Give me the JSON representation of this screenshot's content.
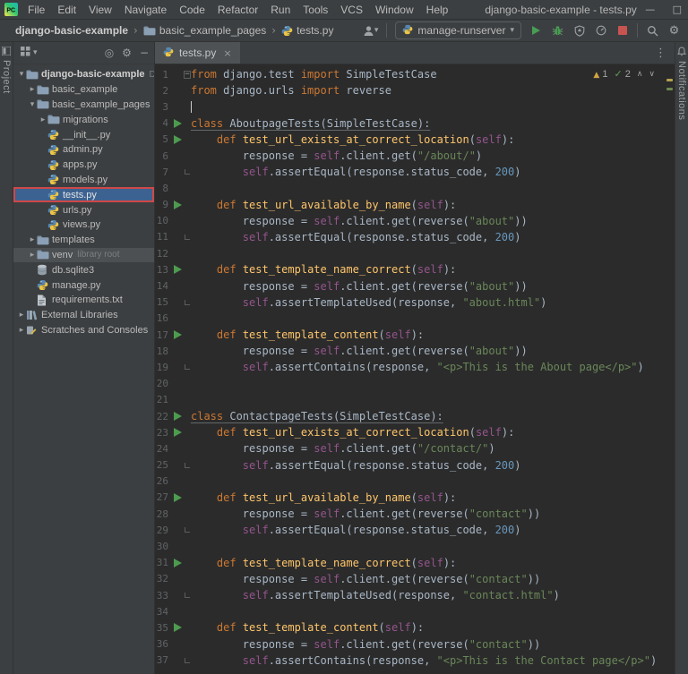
{
  "title_bar": {
    "menus": [
      "File",
      "Edit",
      "View",
      "Navigate",
      "Code",
      "Refactor",
      "Run",
      "Tools",
      "VCS",
      "Window",
      "Help"
    ],
    "title": "django-basic-example - tests.py"
  },
  "toolbar": {
    "breadcrumbs": [
      {
        "label": "django-basic-example"
      },
      {
        "label": "basic_example_pages",
        "icon": "folder"
      },
      {
        "label": "tests.py",
        "icon": "python"
      }
    ],
    "run_config": "manage-runserver"
  },
  "left_stripe": {
    "label": "Project"
  },
  "right_stripe": {
    "label": "Notifications"
  },
  "project": {
    "items": [
      {
        "label": "django-basic-example",
        "suffix": "D:\\",
        "icon": "folder",
        "chev": "down",
        "indent": 0
      },
      {
        "label": "basic_example",
        "icon": "folder",
        "chev": "right",
        "indent": 1
      },
      {
        "label": "basic_example_pages",
        "icon": "folder",
        "chev": "down",
        "indent": 1
      },
      {
        "label": "migrations",
        "icon": "folder",
        "chev": "right",
        "indent": 2
      },
      {
        "label": "__init__.py",
        "icon": "python",
        "indent": 2
      },
      {
        "label": "admin.py",
        "icon": "python",
        "indent": 2
      },
      {
        "label": "apps.py",
        "icon": "python",
        "indent": 2
      },
      {
        "label": "models.py",
        "icon": "python",
        "indent": 2
      },
      {
        "label": "tests.py",
        "icon": "python",
        "indent": 2,
        "selected": true
      },
      {
        "label": "urls.py",
        "icon": "python",
        "indent": 2
      },
      {
        "label": "views.py",
        "icon": "python",
        "indent": 2
      },
      {
        "label": "templates",
        "icon": "folder",
        "chev": "right",
        "indent": 1
      },
      {
        "label": "venv",
        "suffix": "library root",
        "icon": "folder",
        "chev": "right",
        "indent": 1,
        "muted": true
      },
      {
        "label": "db.sqlite3",
        "icon": "database",
        "indent": 1
      },
      {
        "label": "manage.py",
        "icon": "python",
        "indent": 1
      },
      {
        "label": "requirements.txt",
        "icon": "text",
        "indent": 1
      },
      {
        "label": "External Libraries",
        "icon": "libraries",
        "chev": "right",
        "indent": 0
      },
      {
        "label": "Scratches and Consoles",
        "icon": "scratches",
        "chev": "right",
        "indent": 0
      }
    ]
  },
  "tabs": [
    {
      "label": "tests.py"
    }
  ],
  "editor": {
    "inspections": {
      "warnings": "1",
      "passed": "2"
    },
    "lines": [
      {
        "n": 1,
        "fs": true,
        "t": [
          [
            "k",
            "from"
          ],
          [
            "p",
            " django.test "
          ],
          [
            "k",
            "import"
          ],
          [
            "p",
            " SimpleTestCase"
          ]
        ]
      },
      {
        "n": 2,
        "t": [
          [
            "k",
            "from"
          ],
          [
            "p",
            " django.urls "
          ],
          [
            "k",
            "import"
          ],
          [
            "p",
            " reverse"
          ]
        ]
      },
      {
        "n": 3,
        "cursor": true,
        "t": []
      },
      {
        "n": 4,
        "run": true,
        "u": true,
        "t": [
          [
            "k",
            "class"
          ],
          [
            "p",
            " AboutpageTests(SimpleTestCase):"
          ]
        ]
      },
      {
        "n": 5,
        "run": true,
        "t": [
          [
            "p",
            "    "
          ],
          [
            "k",
            "def"
          ],
          [
            "p",
            " "
          ],
          [
            "f",
            "test_url_exists_at_correct_location"
          ],
          [
            "p",
            "("
          ],
          [
            "sf",
            "self"
          ],
          [
            "p",
            "):"
          ]
        ]
      },
      {
        "n": 6,
        "t": [
          [
            "p",
            "        response = "
          ],
          [
            "sf",
            "self"
          ],
          [
            "p",
            ".client.get("
          ],
          [
            "s",
            "\"/about/\""
          ],
          [
            "p",
            ")"
          ]
        ]
      },
      {
        "n": 7,
        "fe": true,
        "t": [
          [
            "p",
            "        "
          ],
          [
            "sf",
            "self"
          ],
          [
            "p",
            ".assertEqual(response.status_code, "
          ],
          [
            "nm",
            "200"
          ],
          [
            "p",
            ")"
          ]
        ]
      },
      {
        "n": 8,
        "t": []
      },
      {
        "n": 9,
        "run": true,
        "t": [
          [
            "p",
            "    "
          ],
          [
            "k",
            "def"
          ],
          [
            "p",
            " "
          ],
          [
            "f",
            "test_url_available_by_name"
          ],
          [
            "p",
            "("
          ],
          [
            "sf",
            "self"
          ],
          [
            "p",
            "):"
          ]
        ]
      },
      {
        "n": 10,
        "t": [
          [
            "p",
            "        response = "
          ],
          [
            "sf",
            "self"
          ],
          [
            "p",
            ".client.get(reverse("
          ],
          [
            "s",
            "\"about\""
          ],
          [
            "p",
            "))"
          ]
        ]
      },
      {
        "n": 11,
        "fe": true,
        "t": [
          [
            "p",
            "        "
          ],
          [
            "sf",
            "self"
          ],
          [
            "p",
            ".assertEqual(response.status_code, "
          ],
          [
            "nm",
            "200"
          ],
          [
            "p",
            ")"
          ]
        ]
      },
      {
        "n": 12,
        "t": []
      },
      {
        "n": 13,
        "run": true,
        "t": [
          [
            "p",
            "    "
          ],
          [
            "k",
            "def"
          ],
          [
            "p",
            " "
          ],
          [
            "f",
            "test_template_name_correct"
          ],
          [
            "p",
            "("
          ],
          [
            "sf",
            "self"
          ],
          [
            "p",
            "):"
          ]
        ]
      },
      {
        "n": 14,
        "t": [
          [
            "p",
            "        response = "
          ],
          [
            "sf",
            "self"
          ],
          [
            "p",
            ".client.get(reverse("
          ],
          [
            "s",
            "\"about\""
          ],
          [
            "p",
            "))"
          ]
        ]
      },
      {
        "n": 15,
        "fe": true,
        "t": [
          [
            "p",
            "        "
          ],
          [
            "sf",
            "self"
          ],
          [
            "p",
            ".assertTemplateUsed(response, "
          ],
          [
            "s",
            "\"about.html\""
          ],
          [
            "p",
            ")"
          ]
        ]
      },
      {
        "n": 16,
        "t": []
      },
      {
        "n": 17,
        "run": true,
        "t": [
          [
            "p",
            "    "
          ],
          [
            "k",
            "def"
          ],
          [
            "p",
            " "
          ],
          [
            "f",
            "test_template_content"
          ],
          [
            "p",
            "("
          ],
          [
            "sf",
            "self"
          ],
          [
            "p",
            "):"
          ]
        ]
      },
      {
        "n": 18,
        "t": [
          [
            "p",
            "        response = "
          ],
          [
            "sf",
            "self"
          ],
          [
            "p",
            ".client.get(reverse("
          ],
          [
            "s",
            "\"about\""
          ],
          [
            "p",
            "))"
          ]
        ]
      },
      {
        "n": 19,
        "fe": true,
        "t": [
          [
            "p",
            "        "
          ],
          [
            "sf",
            "self"
          ],
          [
            "p",
            ".assertContains(response, "
          ],
          [
            "s",
            "\"<p>This is the About page</p>\""
          ],
          [
            "p",
            ")"
          ]
        ]
      },
      {
        "n": 20,
        "t": []
      },
      {
        "n": 21,
        "t": []
      },
      {
        "n": 22,
        "run": true,
        "u": true,
        "t": [
          [
            "k",
            "class"
          ],
          [
            "p",
            " ContactpageTests(SimpleTestCase):"
          ]
        ]
      },
      {
        "n": 23,
        "run": true,
        "t": [
          [
            "p",
            "    "
          ],
          [
            "k",
            "def"
          ],
          [
            "p",
            " "
          ],
          [
            "f",
            "test_url_exists_at_correct_location"
          ],
          [
            "p",
            "("
          ],
          [
            "sf",
            "self"
          ],
          [
            "p",
            "):"
          ]
        ]
      },
      {
        "n": 24,
        "t": [
          [
            "p",
            "        response = "
          ],
          [
            "sf",
            "self"
          ],
          [
            "p",
            ".client.get("
          ],
          [
            "s",
            "\"/contact/\""
          ],
          [
            "p",
            ")"
          ]
        ]
      },
      {
        "n": 25,
        "fe": true,
        "t": [
          [
            "p",
            "        "
          ],
          [
            "sf",
            "self"
          ],
          [
            "p",
            ".assertEqual(response.status_code, "
          ],
          [
            "nm",
            "200"
          ],
          [
            "p",
            ")"
          ]
        ]
      },
      {
        "n": 26,
        "t": []
      },
      {
        "n": 27,
        "run": true,
        "t": [
          [
            "p",
            "    "
          ],
          [
            "k",
            "def"
          ],
          [
            "p",
            " "
          ],
          [
            "f",
            "test_url_available_by_name"
          ],
          [
            "p",
            "("
          ],
          [
            "sf",
            "self"
          ],
          [
            "p",
            "):"
          ]
        ]
      },
      {
        "n": 28,
        "t": [
          [
            "p",
            "        response = "
          ],
          [
            "sf",
            "self"
          ],
          [
            "p",
            ".client.get(reverse("
          ],
          [
            "s",
            "\"contact\""
          ],
          [
            "p",
            "))"
          ]
        ]
      },
      {
        "n": 29,
        "fe": true,
        "t": [
          [
            "p",
            "        "
          ],
          [
            "sf",
            "self"
          ],
          [
            "p",
            ".assertEqual(response.status_code, "
          ],
          [
            "nm",
            "200"
          ],
          [
            "p",
            ")"
          ]
        ]
      },
      {
        "n": 30,
        "t": []
      },
      {
        "n": 31,
        "run": true,
        "t": [
          [
            "p",
            "    "
          ],
          [
            "k",
            "def"
          ],
          [
            "p",
            " "
          ],
          [
            "f",
            "test_template_name_correct"
          ],
          [
            "p",
            "("
          ],
          [
            "sf",
            "self"
          ],
          [
            "p",
            "):"
          ]
        ]
      },
      {
        "n": 32,
        "t": [
          [
            "p",
            "        response = "
          ],
          [
            "sf",
            "self"
          ],
          [
            "p",
            ".client.get(reverse("
          ],
          [
            "s",
            "\"contact\""
          ],
          [
            "p",
            "))"
          ]
        ]
      },
      {
        "n": 33,
        "fe": true,
        "t": [
          [
            "p",
            "        "
          ],
          [
            "sf",
            "self"
          ],
          [
            "p",
            ".assertTemplateUsed(response, "
          ],
          [
            "s",
            "\"contact.html\""
          ],
          [
            "p",
            ")"
          ]
        ]
      },
      {
        "n": 34,
        "t": []
      },
      {
        "n": 35,
        "run": true,
        "t": [
          [
            "p",
            "    "
          ],
          [
            "k",
            "def"
          ],
          [
            "p",
            " "
          ],
          [
            "f",
            "test_template_content"
          ],
          [
            "p",
            "("
          ],
          [
            "sf",
            "self"
          ],
          [
            "p",
            "):"
          ]
        ]
      },
      {
        "n": 36,
        "t": [
          [
            "p",
            "        response = "
          ],
          [
            "sf",
            "self"
          ],
          [
            "p",
            ".client.get(reverse("
          ],
          [
            "s",
            "\"contact\""
          ],
          [
            "p",
            "))"
          ]
        ]
      },
      {
        "n": 37,
        "fe": true,
        "t": [
          [
            "p",
            "        "
          ],
          [
            "sf",
            "self"
          ],
          [
            "p",
            ".assertContains(response, "
          ],
          [
            "s",
            "\"<p>This is the Contact page</p>\""
          ],
          [
            "p",
            ")"
          ]
        ]
      }
    ]
  },
  "colors": {
    "panel_bg": "#3c3f41",
    "editor_bg": "#2b2b2b",
    "selection_blue": "#3c6291",
    "highlight_border_red": "#cf4848",
    "run_green": "#499c54",
    "stop_red": "#c75450",
    "keyword_orange": "#cc7832",
    "string_green": "#6a8759",
    "number_blue": "#6897bb",
    "function_yellow": "#ffc66b",
    "self_purple": "#94558d",
    "warning_yellow": "#d0a343"
  }
}
